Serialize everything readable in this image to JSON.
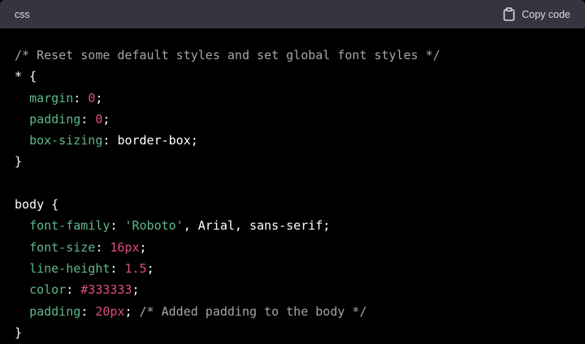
{
  "header": {
    "language": "css",
    "copy_label": "Copy code"
  },
  "colors": {
    "header_bg": "#343541",
    "code_bg": "#000000",
    "comment": "#a6a6a6",
    "property": "#5fb88a",
    "number": "#e0507a",
    "text": "#ffffff"
  },
  "icons": {
    "copy": "clipboard-icon"
  },
  "code": {
    "l1_comment": "/* Reset some default styles and set global font styles */",
    "l2_selector": "* {",
    "l3_prop": "margin",
    "l3_val": "0",
    "l4_prop": "padding",
    "l4_val": "0",
    "l5_prop": "box-sizing",
    "l5_val": "border-box",
    "l6_close": "}",
    "l8_selector": "body {",
    "l9_prop": "font-family",
    "l9_str": "'Roboto'",
    "l9_rest": ", Arial, sans-serif",
    "l10_prop": "font-size",
    "l10_val": "16px",
    "l11_prop": "line-height",
    "l11_val": "1.5",
    "l12_prop": "color",
    "l12_val": "#333333",
    "l13_prop": "padding",
    "l13_val": "20px",
    "l13_comment": "/* Added padding to the body */",
    "l14_close": "}"
  }
}
